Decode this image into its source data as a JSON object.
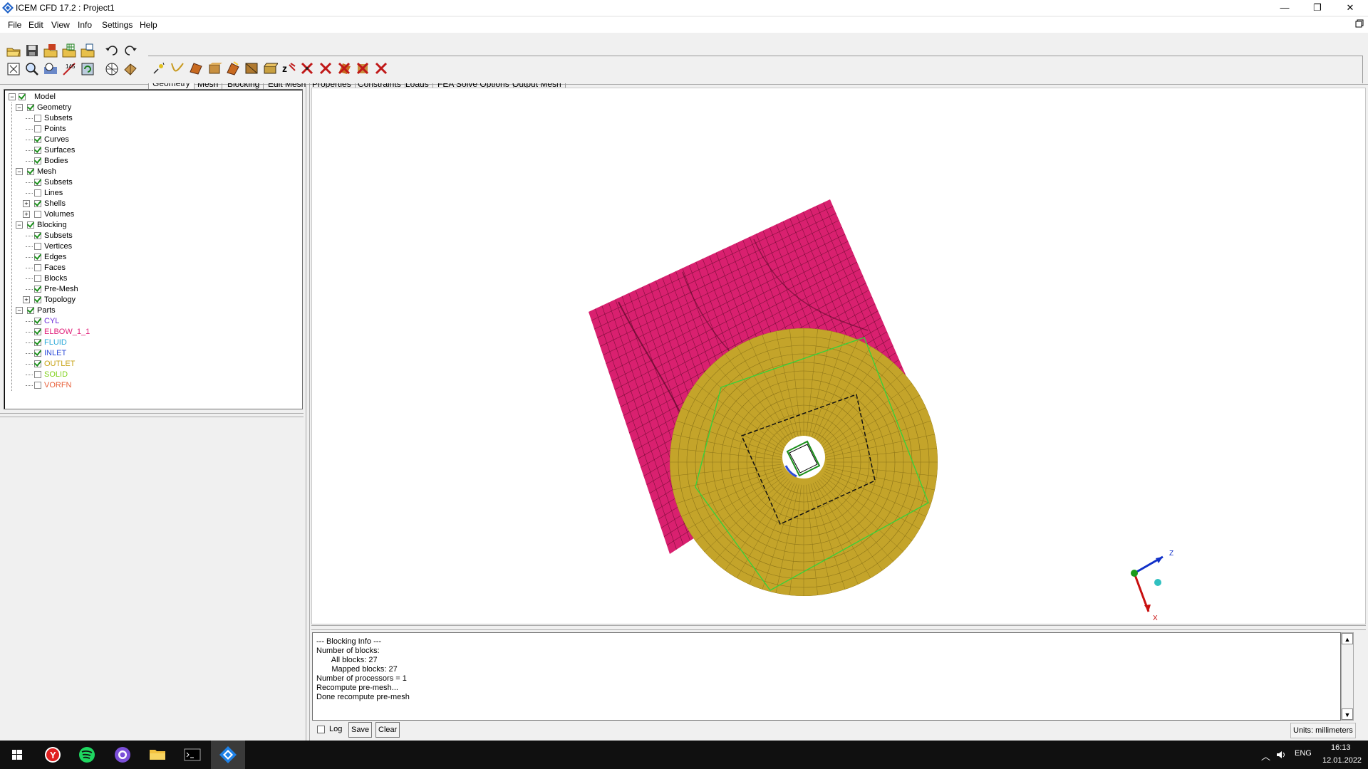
{
  "window": {
    "title": "ICEM CFD 17.2 : Project1",
    "minimize": "—",
    "maximize": "❐",
    "close": "✕"
  },
  "menu": [
    "File",
    "Edit",
    "View",
    "Info",
    "Settings",
    "Help"
  ],
  "tabs": [
    "Geometry",
    "Mesh",
    "Blocking",
    "Edit Mesh",
    "Properties",
    "Constraints",
    "Loads",
    "FEA Solve Options",
    "Output Mesh"
  ],
  "tree": {
    "model": "Model",
    "geometry": "Geometry",
    "geometry_items": [
      {
        "label": "Subsets",
        "checked": false
      },
      {
        "label": "Points",
        "checked": false
      },
      {
        "label": "Curves",
        "checked": true
      },
      {
        "label": "Surfaces",
        "checked": true
      },
      {
        "label": "Bodies",
        "checked": true
      }
    ],
    "mesh": "Mesh",
    "mesh_items": [
      {
        "label": "Subsets",
        "checked": true
      },
      {
        "label": "Lines",
        "checked": false
      },
      {
        "label": "Shells",
        "checked": true
      },
      {
        "label": "Volumes",
        "checked": false
      }
    ],
    "blocking": "Blocking",
    "blocking_items": [
      {
        "label": "Subsets",
        "checked": true
      },
      {
        "label": "Vertices",
        "checked": false
      },
      {
        "label": "Edges",
        "checked": true
      },
      {
        "label": "Faces",
        "checked": false
      },
      {
        "label": "Blocks",
        "checked": false
      },
      {
        "label": "Pre-Mesh",
        "checked": true
      },
      {
        "label": "Topology",
        "checked": true
      }
    ],
    "parts": "Parts",
    "parts_items": [
      {
        "label": "CYL",
        "checked": true,
        "color": "#6b2bd8"
      },
      {
        "label": "ELBOW_1_1",
        "checked": true,
        "color": "#e0207a"
      },
      {
        "label": "FLUID",
        "checked": true,
        "color": "#2aa8d8"
      },
      {
        "label": "INLET",
        "checked": true,
        "color": "#2c4bd8"
      },
      {
        "label": "OUTLET",
        "checked": true,
        "color": "#c7a214"
      },
      {
        "label": "SOLID",
        "checked": false,
        "color": "#7fd11a"
      },
      {
        "label": "VORFN",
        "checked": false,
        "color": "#e8603a"
      }
    ]
  },
  "log": {
    "lines": [
      "--- Blocking Info ---",
      "Number of blocks:",
      "       All blocks: 27",
      "       Mapped blocks: 27",
      "Number of processors = 1",
      "Recompute pre-mesh...",
      "Done recompute pre-mesh"
    ],
    "log_label": "Log",
    "save_label": "Save",
    "clear_label": "Clear",
    "units": "Units: millimeters"
  },
  "triad": {
    "z": "Z",
    "x": "X"
  },
  "colors": {
    "elbow": "#d9206f",
    "outlet": "#c4a42a",
    "triad_z": "#1030c8",
    "triad_x": "#c81010"
  },
  "taskbar": {
    "lang": "ENG",
    "time": "16:13",
    "date": "12.01.2022"
  }
}
